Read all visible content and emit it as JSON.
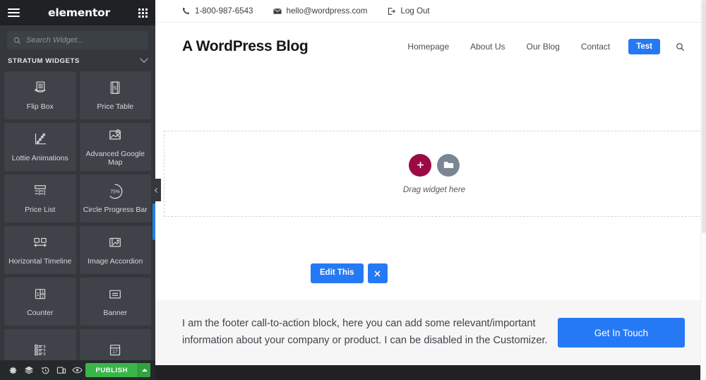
{
  "panel": {
    "brand": "elementor",
    "menu_icon": "hamburger-icon",
    "apps_icon": "app-grid-icon",
    "search": {
      "placeholder": "Search Widget...",
      "value": "",
      "icon": "search-icon"
    },
    "category": {
      "label": "STRATUM WIDGETS",
      "expanded": true,
      "chevron": "chevron-down-icon"
    },
    "widgets": [
      {
        "label": "Flip Box",
        "icon": "flip-box-icon"
      },
      {
        "label": "Price Table",
        "icon": "price-table-icon"
      },
      {
        "label": "Lottie Animations",
        "icon": "lottie-animations-icon"
      },
      {
        "label": "Advanced Google Map",
        "icon": "advanced-google-map-icon"
      },
      {
        "label": "Price List",
        "icon": "price-list-icon"
      },
      {
        "label": "Circle Progress Bar",
        "icon": "circle-progress-bar-icon",
        "icon_text": "75%"
      },
      {
        "label": "Horizontal Timeline",
        "icon": "horizontal-timeline-icon"
      },
      {
        "label": "Image Accordion",
        "icon": "image-accordion-icon"
      },
      {
        "label": "Counter",
        "icon": "counter-icon"
      },
      {
        "label": "Banner",
        "icon": "banner-icon"
      },
      {
        "label": "",
        "icon": "price-menu-icon"
      },
      {
        "label": "",
        "icon": "calendar-icon",
        "icon_text": "17"
      }
    ],
    "footer": {
      "settings_icon": "gear-icon",
      "navigator_icon": "layers-icon",
      "history_icon": "history-icon",
      "responsive_icon": "responsive-mode-icon",
      "preview_icon": "eye-icon",
      "publish_label": "PUBLISH",
      "publish_caret": "caret-up-icon"
    },
    "colors": {
      "bg": "#34383c",
      "header_bg": "#1f2124",
      "tile": "#3f4349",
      "publish": "#39b54a",
      "scroll_thumb": "#1f7fe8"
    }
  },
  "preview": {
    "topbar": [
      {
        "icon": "phone-icon",
        "text": "1-800-987-6543"
      },
      {
        "icon": "envelope-icon",
        "text": "hello@wordpress.com"
      },
      {
        "icon": "logout-icon",
        "text": "Log Out"
      }
    ],
    "site_title": "A WordPress Blog",
    "nav": [
      {
        "label": "Homepage"
      },
      {
        "label": "About Us"
      },
      {
        "label": "Our Blog"
      },
      {
        "label": "Contact"
      }
    ],
    "nav_button": "Test",
    "nav_search_icon": "search-icon",
    "dropzone": {
      "add_icon": "plus-icon",
      "folder_icon": "folder-icon",
      "text": "Drag widget here"
    },
    "section_controls": {
      "edit_label": "Edit This",
      "close_icon": "close-icon"
    },
    "cta": {
      "text": "I am the footer call-to-action block, here you can add some relevant/important information about your company or product. I can be disabled in the Customizer.",
      "button": "Get In Touch"
    },
    "collapse_icon": "chevron-left-icon",
    "colors": {
      "accent": "#2679f5",
      "cta_bg": "#f6f6f6",
      "add_btn": "#9b0a46",
      "folder_btn": "#7a8693",
      "strip": "#1f2124"
    }
  }
}
